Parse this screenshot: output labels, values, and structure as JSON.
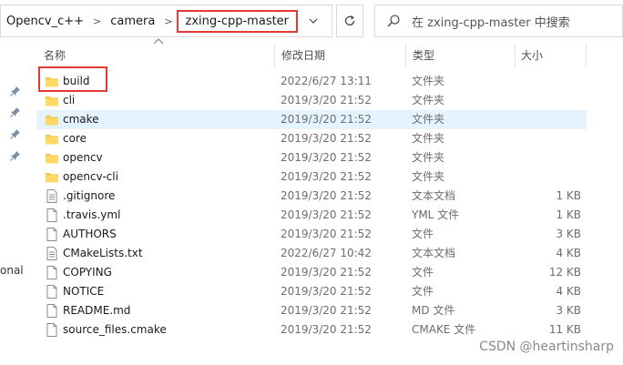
{
  "breadcrumb": {
    "items": [
      "Opencv_c++",
      "camera",
      "zxing-cpp-master"
    ]
  },
  "search": {
    "placeholder": "在 zxing-cpp-master 中搜索"
  },
  "columns": {
    "name": "名称",
    "date": "修改日期",
    "type": "类型",
    "size": "大小"
  },
  "nav": {
    "partial_label": "onal"
  },
  "files": [
    {
      "name": "build",
      "date": "2022/6/27 13:11",
      "type": "文件夹",
      "size": "",
      "icon": "folder"
    },
    {
      "name": "cli",
      "date": "2019/3/20 21:52",
      "type": "文件夹",
      "size": "",
      "icon": "folder"
    },
    {
      "name": "cmake",
      "date": "2019/3/20 21:52",
      "type": "文件夹",
      "size": "",
      "icon": "folder"
    },
    {
      "name": "core",
      "date": "2019/3/20 21:52",
      "type": "文件夹",
      "size": "",
      "icon": "folder"
    },
    {
      "name": "opencv",
      "date": "2019/3/20 21:52",
      "type": "文件夹",
      "size": "",
      "icon": "folder"
    },
    {
      "name": "opencv-cli",
      "date": "2019/3/20 21:52",
      "type": "文件夹",
      "size": "",
      "icon": "folder"
    },
    {
      "name": ".gitignore",
      "date": "2019/3/20 21:52",
      "type": "文本文档",
      "size": "1 KB",
      "icon": "text-file"
    },
    {
      "name": ".travis.yml",
      "date": "2019/3/20 21:52",
      "type": "YML 文件",
      "size": "1 KB",
      "icon": "file"
    },
    {
      "name": "AUTHORS",
      "date": "2019/3/20 21:52",
      "type": "文件",
      "size": "3 KB",
      "icon": "file"
    },
    {
      "name": "CMakeLists.txt",
      "date": "2022/6/27 10:42",
      "type": "文本文档",
      "size": "4 KB",
      "icon": "text-file"
    },
    {
      "name": "COPYING",
      "date": "2019/3/20 21:52",
      "type": "文件",
      "size": "12 KB",
      "icon": "file"
    },
    {
      "name": "NOTICE",
      "date": "2019/3/20 21:52",
      "type": "文件",
      "size": "4 KB",
      "icon": "file"
    },
    {
      "name": "README.md",
      "date": "2019/3/20 21:52",
      "type": "MD 文件",
      "size": "3 KB",
      "icon": "file"
    },
    {
      "name": "source_files.cmake",
      "date": "2019/3/20 21:52",
      "type": "CMAKE 文件",
      "size": "11 KB",
      "icon": "file"
    }
  ],
  "watermark": "CSDN @heartinsharp",
  "colors": {
    "highlight_box": "#e53935",
    "hover_row": "#e5f3ff",
    "folder": "#f3c64c"
  }
}
